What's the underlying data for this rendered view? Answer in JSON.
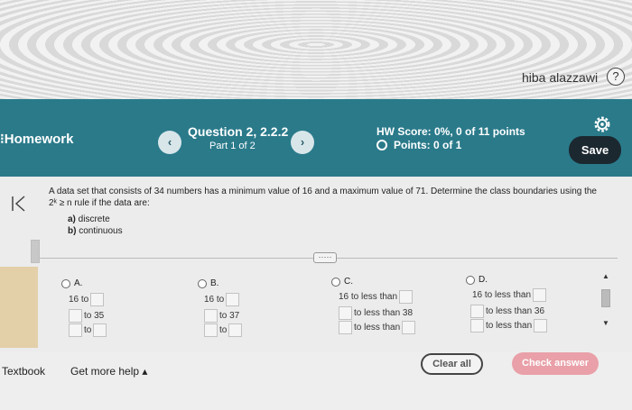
{
  "top": {
    "user_name": "hiba alazzawi",
    "help_label": "?"
  },
  "header": {
    "homework_title": "Homework",
    "prev_arrow": "‹",
    "next_arrow": "›",
    "question_title": "Question 2, 2.2.2",
    "part": "Part 1 of 2",
    "hw_score": "HW Score: 0%, 0 of 11 points",
    "points": "Points: 0 of 1",
    "save_label": "Save"
  },
  "question": {
    "line1": "A data set that consists of 34 numbers has a minimum value of 16 and a maximum value of 71. Determine the class boundaries using the",
    "line2": "2ᵏ ≥ n rule if the data are:",
    "a_letter": "a)",
    "a_text": " discrete",
    "b_letter": "b)",
    "b_text": " continuous",
    "expand_label": "·····"
  },
  "options": {
    "A": {
      "label": "A.",
      "r1": "16 to",
      "r2": "to 35",
      "r3": "to"
    },
    "B": {
      "label": "B.",
      "r1": "16 to",
      "r2": "to 37",
      "r3": "to"
    },
    "C": {
      "label": "C.",
      "r1": "16 to less than",
      "r2": "to less than 38",
      "r3": "to less than"
    },
    "D": {
      "label": "D.",
      "r1": "16 to less than",
      "r2": "to less than 36",
      "r3": "to less than"
    }
  },
  "footer": {
    "textbook": "Textbook",
    "get_help": "Get more help ▴",
    "clear_all": "Clear all",
    "check_answer": "Check answer"
  }
}
